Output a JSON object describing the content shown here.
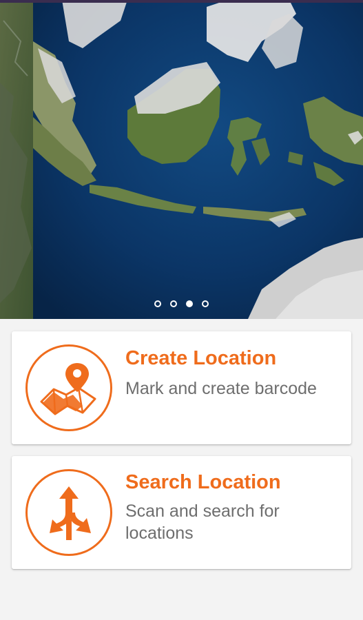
{
  "carousel": {
    "slide_count": 4,
    "active_slide": 3,
    "image": "satellite-map-southeast-asia"
  },
  "cards": {
    "create": {
      "title": "Create Location",
      "subtitle": "Mark and create barcode",
      "icon": "map-pin-icon"
    },
    "search": {
      "title": "Search Location",
      "subtitle": "Scan and search for locations",
      "icon": "directions-arrows-icon"
    }
  },
  "colors": {
    "accent": "#ef6c1c",
    "subtitle": "#6e6e6e",
    "background": "#f3f3f3",
    "ocean": "#0b3a6b"
  }
}
